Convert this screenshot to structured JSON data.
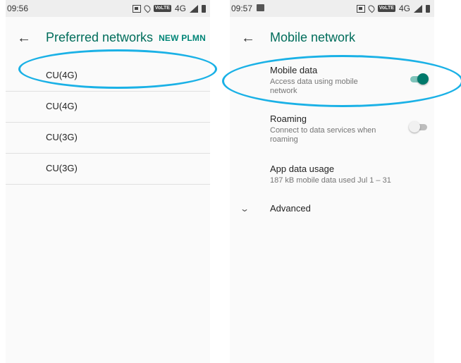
{
  "left_screen": {
    "status": {
      "time": "09:56",
      "network": "4G",
      "volte": "VoLTE"
    },
    "appbar": {
      "back_icon": "arrow-back-icon",
      "title": "Preferred networks",
      "action": "NEW PLMN"
    },
    "networks": [
      "CU(4G)",
      "CU(4G)",
      "CU(3G)",
      "CU(3G)"
    ]
  },
  "right_screen": {
    "status": {
      "time": "09:57",
      "network": "4G",
      "volte": "VoLTE"
    },
    "appbar": {
      "back_icon": "arrow-back-icon",
      "title": "Mobile network"
    },
    "mobile_data": {
      "title": "Mobile data",
      "summary": "Access data using mobile network",
      "enabled": true
    },
    "roaming": {
      "title": "Roaming",
      "summary": "Connect to data services when roaming",
      "enabled": false
    },
    "app_data_usage": {
      "title": "App data usage",
      "summary": "187 kB mobile data used Jul 1 – 31"
    },
    "advanced": {
      "label": "Advanced",
      "icon": "chevron-down-icon"
    }
  },
  "colors": {
    "accent": "#00796b",
    "title": "#006d5b",
    "highlight": "#1ab1e6"
  }
}
